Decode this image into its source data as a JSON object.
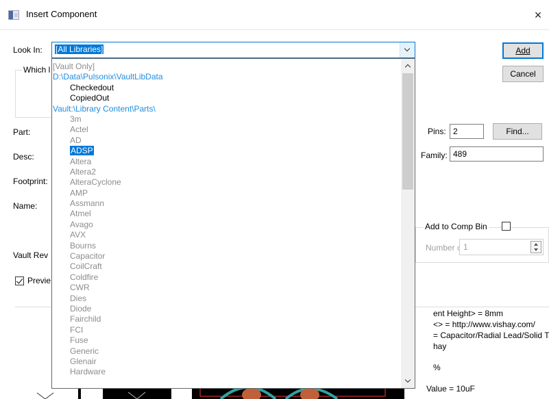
{
  "window": {
    "title": "Insert Component",
    "close_label": "×"
  },
  "look_in": {
    "label": "Look In:",
    "value": "[All Libraries]"
  },
  "buttons": {
    "add": "Add",
    "cancel": "Cancel",
    "find": "Find..."
  },
  "group": {
    "which_label": "Which l"
  },
  "fields": {
    "part_label": "Part:",
    "desc_label": "Desc:",
    "footprint_label": "Footprint:",
    "name_label": "Name:",
    "vault_rev_label": "Vault Rev",
    "pins_label": "Pins:",
    "pins_value": "2",
    "family_label": "Family:",
    "family_value": "489"
  },
  "comp_bin": {
    "add_label": "Add to Comp Bin",
    "copies_label": "Number of Copies:",
    "copies_value": "1"
  },
  "preview": {
    "checkbox_label": "Previe",
    "lines": [
      "ent Height> = 8mm",
      "<> = http://www.vishay.com/",
      "= Capacitor/Radial Lead/Solid Tar",
      "hay",
      "%",
      "Value = 10uF"
    ]
  },
  "dropdown": {
    "items": [
      {
        "text": "[Vault Only]",
        "color": "gray",
        "level": 0
      },
      {
        "text": "D:\\Data\\Pulsonix\\VaultLibData",
        "color": "blue",
        "level": 0
      },
      {
        "text": "Checkedout",
        "color": "black",
        "level": 1
      },
      {
        "text": "CopiedOut",
        "color": "black",
        "level": 1
      },
      {
        "text": "Vault:\\Library Content\\Parts\\",
        "color": "blue",
        "level": 0
      },
      {
        "text": "3m",
        "color": "gray",
        "level": 1
      },
      {
        "text": "Actel",
        "color": "gray",
        "level": 1
      },
      {
        "text": "AD",
        "color": "gray",
        "level": 1
      },
      {
        "text": "ADSP",
        "color": "gray",
        "level": 1,
        "selected": true
      },
      {
        "text": "Altera",
        "color": "gray",
        "level": 1
      },
      {
        "text": "Altera2",
        "color": "gray",
        "level": 1
      },
      {
        "text": "AlteraCyclone",
        "color": "gray",
        "level": 1
      },
      {
        "text": "AMP",
        "color": "gray",
        "level": 1
      },
      {
        "text": "Assmann",
        "color": "gray",
        "level": 1
      },
      {
        "text": "Atmel",
        "color": "gray",
        "level": 1
      },
      {
        "text": "Avago",
        "color": "gray",
        "level": 1
      },
      {
        "text": "AVX",
        "color": "gray",
        "level": 1
      },
      {
        "text": "Bourns",
        "color": "gray",
        "level": 1
      },
      {
        "text": "Capacitor",
        "color": "gray",
        "level": 1
      },
      {
        "text": "CoilCraft",
        "color": "gray",
        "level": 1
      },
      {
        "text": "Coldfire",
        "color": "gray",
        "level": 1
      },
      {
        "text": "CWR",
        "color": "gray",
        "level": 1
      },
      {
        "text": "Dies",
        "color": "gray",
        "level": 1
      },
      {
        "text": "Diode",
        "color": "gray",
        "level": 1
      },
      {
        "text": "Fairchild",
        "color": "gray",
        "level": 1
      },
      {
        "text": "FCI",
        "color": "gray",
        "level": 1
      },
      {
        "text": "Fuse",
        "color": "gray",
        "level": 1
      },
      {
        "text": "Generic",
        "color": "gray",
        "level": 1
      },
      {
        "text": "Glenair",
        "color": "gray",
        "level": 1
      },
      {
        "text": "Hardware",
        "color": "gray",
        "level": 1
      }
    ]
  },
  "colors": {
    "accent": "#0078d7",
    "library_blue": "#1e8de0",
    "disabled_gray": "#8c8c8c"
  }
}
